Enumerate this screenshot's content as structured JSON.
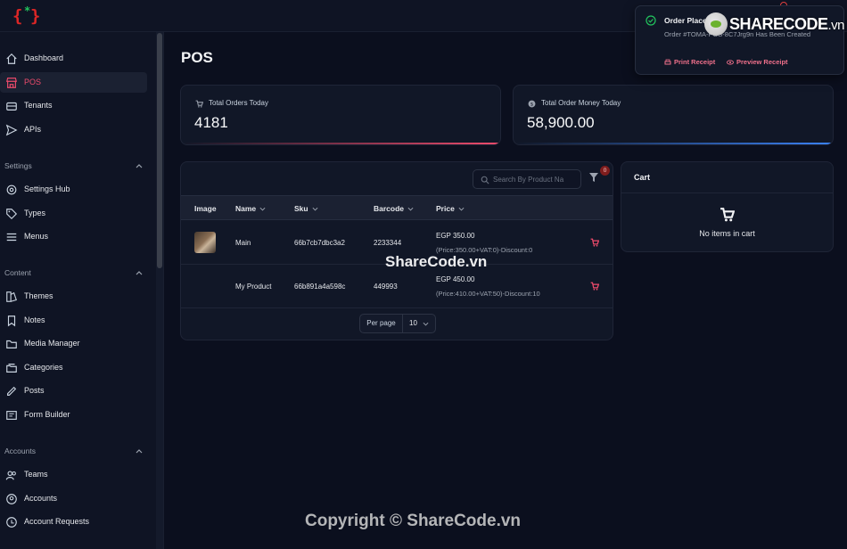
{
  "sidebar": {
    "items": [
      {
        "label": "Dashboard",
        "icon": "home-icon"
      },
      {
        "label": "POS",
        "icon": "store-icon",
        "active": true
      },
      {
        "label": "Tenants",
        "icon": "tenants-icon"
      },
      {
        "label": "APIs",
        "icon": "send-icon"
      }
    ],
    "settings_head": "Settings",
    "settings_items": [
      {
        "label": "Settings Hub",
        "icon": "gear-icon"
      },
      {
        "label": "Types",
        "icon": "tag-icon"
      },
      {
        "label": "Menus",
        "icon": "menu-icon"
      }
    ],
    "content_head": "Content",
    "content_items": [
      {
        "label": "Themes",
        "icon": "palette-icon"
      },
      {
        "label": "Notes",
        "icon": "bookmark-icon"
      },
      {
        "label": "Media Manager",
        "icon": "folder-icon"
      },
      {
        "label": "Categories",
        "icon": "categories-icon"
      },
      {
        "label": "Posts",
        "icon": "pen-icon"
      },
      {
        "label": "Form Builder",
        "icon": "form-icon"
      }
    ],
    "accounts_head": "Accounts",
    "accounts_items": [
      {
        "label": "Teams",
        "icon": "teams-icon"
      },
      {
        "label": "Accounts",
        "icon": "user-circle-icon"
      },
      {
        "label": "Account Requests",
        "icon": "account-request-icon"
      }
    ]
  },
  "page": {
    "title": "POS"
  },
  "stats": [
    {
      "label": "Total Orders Today",
      "value": "4181",
      "icon": "cart-icon",
      "accent": "#ef4b6c"
    },
    {
      "label": "Total Order Money Today",
      "value": "58,900.00",
      "icon": "money-icon",
      "accent": "#3b82f6"
    }
  ],
  "table": {
    "search_placeholder": "Search By Product Na",
    "filter_count": "0",
    "columns": [
      "Image",
      "Name",
      "Sku",
      "Barcode",
      "Price"
    ],
    "rows": [
      {
        "name": "Main",
        "sku": "66b7cb7dbc3a2",
        "barcode": "2233344",
        "price": "EGP 350.00",
        "price_detail": "(Price:350.00+VAT:0)-Discount:0",
        "has_image": true
      },
      {
        "name": "My Product",
        "sku": "66b891a4a598c",
        "barcode": "449993",
        "price": "EGP 450.00",
        "price_detail": "(Price:410.00+VAT:50)-Discount:10",
        "has_image": false
      }
    ],
    "per_page_label": "Per page",
    "per_page_value": "10"
  },
  "cart": {
    "title": "Cart",
    "empty_text": "No items in cart"
  },
  "toast": {
    "title": "Order Placed",
    "body": "Order #TOMA-POS-8C7Jrg9n Has Been Created",
    "print_label": "Print Receipt",
    "preview_label": "Preview Receipt"
  },
  "watermarks": {
    "top_brand": "SHARECODE",
    "top_suffix": ".vn",
    "middle": "ShareCode.vn",
    "bottom": "Copyright © ShareCode.vn"
  },
  "colors": {
    "accent": "#ef4b6c",
    "background": "#0b0f1e",
    "panel": "#111727"
  }
}
